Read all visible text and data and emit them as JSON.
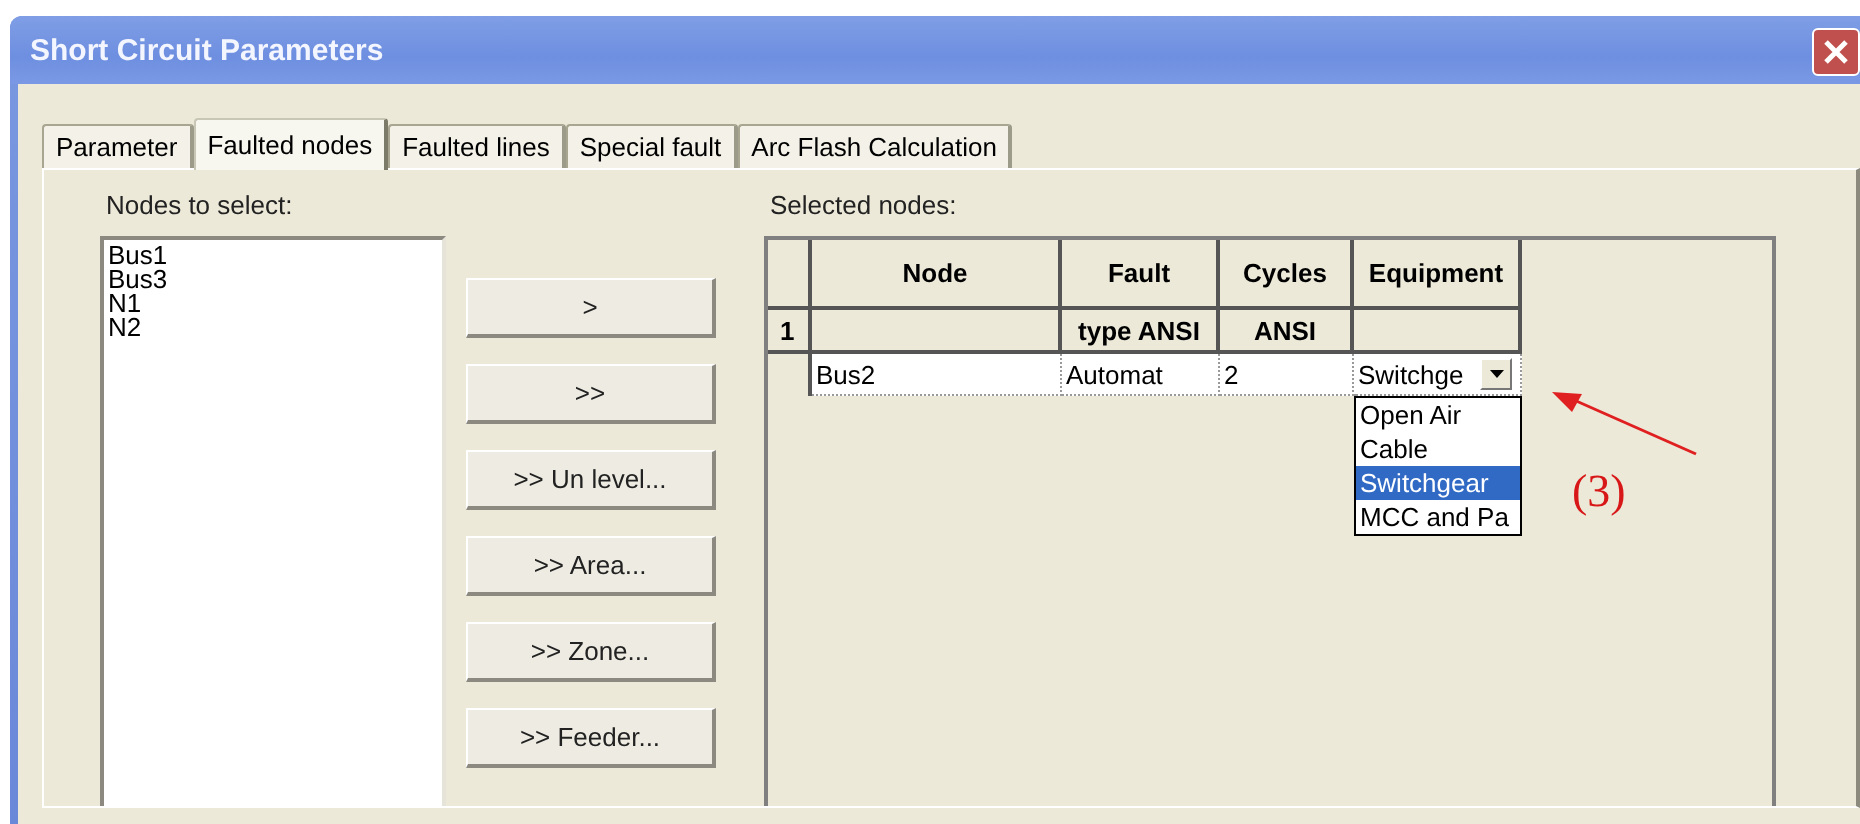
{
  "window": {
    "title": "Short Circuit Parameters"
  },
  "tabs": [
    {
      "label": "Parameter",
      "selected": false
    },
    {
      "label": "Faulted nodes",
      "selected": true
    },
    {
      "label": "Faulted lines",
      "selected": false
    },
    {
      "label": "Special fault",
      "selected": false
    },
    {
      "label": "Arc Flash Calculation",
      "selected": false
    }
  ],
  "nodes_to_select": {
    "label": "Nodes to select:",
    "items": [
      "Bus1",
      "Bus3",
      "N1",
      "N2"
    ]
  },
  "buttons": [
    ">",
    ">>",
    ">> Un level...",
    ">> Area...",
    ">> Zone...",
    ">> Feeder..."
  ],
  "selected_nodes": {
    "label": "Selected nodes:",
    "row_number": "1",
    "columns": [
      {
        "title": "Node"
      },
      {
        "title": "Fault",
        "subtitle": "type ANSI"
      },
      {
        "title": "Cycles",
        "subtitle": "ANSI"
      },
      {
        "title": "Equipment"
      }
    ],
    "rows": [
      {
        "cells": [
          "Bus2",
          "Automat",
          "2"
        ],
        "equipment": "Switchge"
      }
    ],
    "dropdown_options": [
      {
        "label": "Open Air",
        "selected": false
      },
      {
        "label": "Cable",
        "selected": false
      },
      {
        "label": "Switchgear",
        "selected": true
      },
      {
        "label": "MCC and Pa",
        "selected": false
      }
    ]
  },
  "annotation": {
    "text": "(3)"
  }
}
